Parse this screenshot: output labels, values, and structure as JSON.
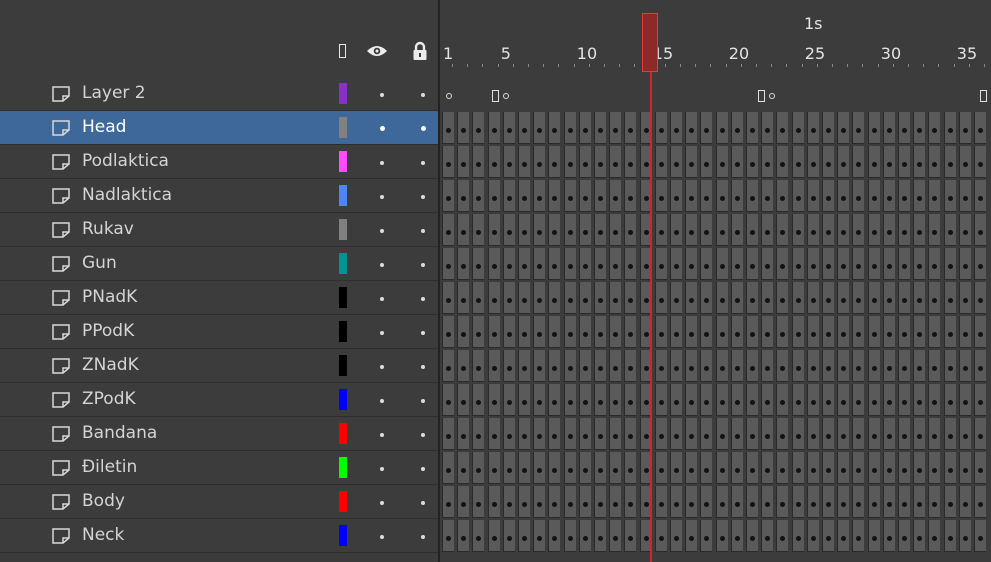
{
  "layer_header": {
    "outline_icon": "outline-box-icon",
    "eye_icon": "eye-icon",
    "lock_icon": "lock-icon"
  },
  "layers": [
    {
      "name": "Layer 2",
      "color": "#8b2fc9",
      "selected": false
    },
    {
      "name": "Head",
      "color": "#808080",
      "selected": true
    },
    {
      "name": "Podlaktica",
      "color": "#ff4aff",
      "selected": false
    },
    {
      "name": "Nadlaktica",
      "color": "#4f86f7",
      "selected": false
    },
    {
      "name": "Rukav",
      "color": "#808080",
      "selected": false
    },
    {
      "name": "Gun",
      "color": "#009494",
      "selected": false
    },
    {
      "name": "PNadK",
      "color": "#000000",
      "selected": false
    },
    {
      "name": "PPodK",
      "color": "#000000",
      "selected": false
    },
    {
      "name": "ZNadK",
      "color": "#000000",
      "selected": false
    },
    {
      "name": "ZPodK",
      "color": "#0000ff",
      "selected": false
    },
    {
      "name": "Bandana",
      "color": "#ff0000",
      "selected": false
    },
    {
      "name": "Đileti​n",
      "color": "#00ff00",
      "selected": false
    },
    {
      "name": "Body",
      "color": "#ff0000",
      "selected": false
    },
    {
      "name": "Neck",
      "color": "#0000ff",
      "selected": false
    }
  ],
  "timeline": {
    "time_label": "1s",
    "frame_labels": [
      "1",
      "5",
      "10",
      "15",
      "20",
      "25",
      "30",
      "35"
    ],
    "current_frame": 14,
    "playhead_color": "#d42424"
  }
}
